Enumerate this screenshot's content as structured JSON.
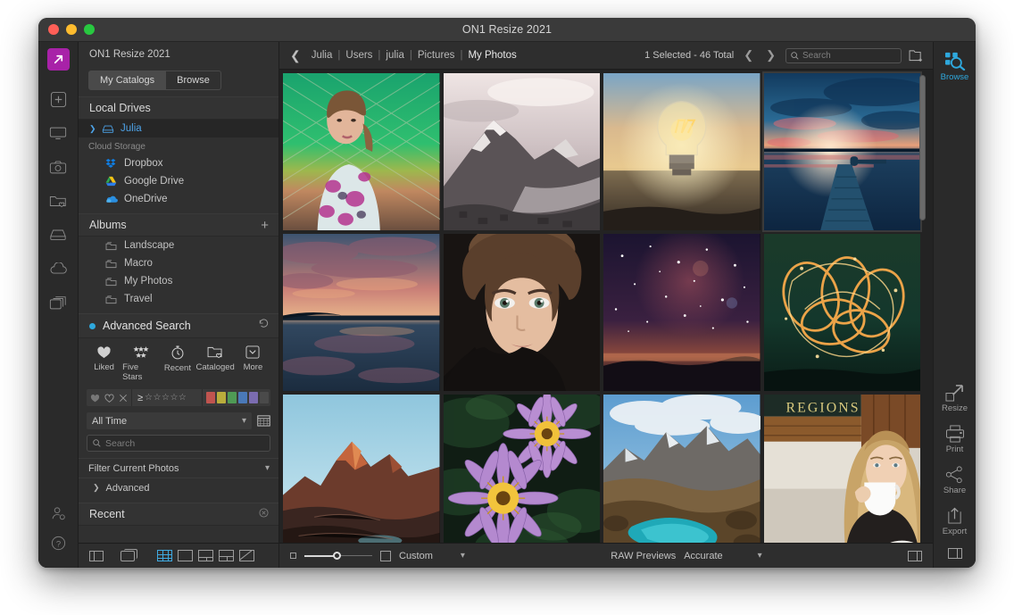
{
  "window": {
    "title": "ON1 Resize 2021",
    "traffic_lights": [
      "close",
      "minimize",
      "zoom"
    ]
  },
  "left_rail": {
    "logo": "on1-logo",
    "icons": [
      "plus-icon",
      "monitor-icon",
      "camera-icon",
      "folder-heart-icon",
      "drive-icon",
      "cloud-icon",
      "copies-icon"
    ],
    "bottom_icons": [
      "user-settings-icon",
      "help-icon"
    ]
  },
  "left_panel": {
    "app_name": "ON1 Resize 2021",
    "tabs": [
      {
        "label": "My Catalogs",
        "active": true
      },
      {
        "label": "Browse",
        "active": false
      }
    ],
    "local_drives": {
      "header": "Local Drives",
      "items": [
        {
          "label": "Julia",
          "selected": true,
          "icon": "drive-icon"
        }
      ]
    },
    "cloud_storage": {
      "header": "Cloud Storage",
      "items": [
        {
          "label": "Dropbox",
          "icon": "dropbox-icon",
          "color": "#0f7ee3"
        },
        {
          "label": "Google Drive",
          "icon": "google-drive-icon",
          "color": "#34a853"
        },
        {
          "label": "OneDrive",
          "icon": "onedrive-icon",
          "color": "#2a8fe0"
        }
      ]
    },
    "albums": {
      "header": "Albums",
      "add_label": "+",
      "items": [
        {
          "label": "Landscape",
          "icon": "album-icon"
        },
        {
          "label": "Macro",
          "icon": "album-icon"
        },
        {
          "label": "My Photos",
          "icon": "album-icon"
        },
        {
          "label": "Travel",
          "icon": "album-icon"
        }
      ]
    },
    "advanced_search": {
      "header": "Advanced Search",
      "bullet_color": "#2ea8dd",
      "reset_icon": "reset-icon",
      "criteria": [
        {
          "label": "Liked",
          "icon": "heart-filled-icon"
        },
        {
          "label": "Five Stars",
          "icon": "five-stars-icon"
        },
        {
          "label": "Recent",
          "icon": "stopwatch-icon"
        },
        {
          "label": "Cataloged",
          "icon": "folder-heart-icon"
        },
        {
          "label": "More",
          "icon": "chevron-down-box-icon"
        }
      ],
      "like_filters": [
        "heart-filled-icon",
        "heart-outline-icon",
        "reject-x-icon"
      ],
      "rating": {
        "operator": "≥",
        "stars": 5,
        "filled": 0
      },
      "color_labels": [
        "#c0544f",
        "#b9ad3c",
        "#4f9a55",
        "#4a79b8",
        "#7b6cb0",
        "#4a4a4a"
      ],
      "time_filter": {
        "value": "All Time",
        "calendar_icon": "calendar-icon"
      },
      "search": {
        "placeholder": "Search",
        "value": "",
        "icon": "search-icon"
      },
      "filter_current": {
        "label": "Filter Current Photos",
        "chevron": "chevron-down-icon"
      },
      "advanced_toggle": {
        "label": "Advanced",
        "chevron": "chevron-right-icon"
      }
    },
    "recent": {
      "header": "Recent",
      "clear_icon": "clear-icon"
    }
  },
  "topbar": {
    "back_icon": "chevron-left-icon",
    "breadcrumb": [
      "Julia",
      "Users",
      "julia",
      "Pictures",
      "My Photos"
    ],
    "status": "1 Selected - 46 Total",
    "prev_icon": "chevron-left-icon",
    "next_icon": "chevron-right-icon",
    "search": {
      "placeholder": "Search",
      "value": "",
      "icon": "search-icon"
    },
    "new_folder_icon": "new-folder-icon"
  },
  "grid": {
    "selected_index": 3,
    "photos": [
      {
        "name": "woman-at-fence",
        "alt": "Woman standing in front of green chain-link fence"
      },
      {
        "name": "snowy-mountain-bay",
        "alt": "Black and white snowy mountain over coastal town"
      },
      {
        "name": "light-bulb-sunset",
        "alt": "Light bulb glowing against sunset sky"
      },
      {
        "name": "sunset-pier",
        "alt": "Wooden pier at blue and pink sunset",
        "selected": true
      },
      {
        "name": "cloud-reflection-lake",
        "alt": "Pink clouds reflected over a calm lake"
      },
      {
        "name": "portrait-woman-closeup",
        "alt": "Close-up portrait of woman with dark background"
      },
      {
        "name": "starry-night-sky",
        "alt": "Night sky with stars and red nebula glow"
      },
      {
        "name": "light-painting-sparks",
        "alt": "Orange sparkler light painting on dark background"
      },
      {
        "name": "red-rock-mountain",
        "alt": "Red rock mountain peak under blue sky"
      },
      {
        "name": "purple-water-lilies",
        "alt": "Two purple water lilies with yellow centers"
      },
      {
        "name": "turquoise-mountain-lake",
        "alt": "Turquoise lake between autumn mountains"
      },
      {
        "name": "woman-drinking-coffee",
        "alt": "Blonde woman drinking from a white mug in a cafe"
      }
    ]
  },
  "bottombar": {
    "thumb_small_icon": "small-square-icon",
    "thumb_large_icon": "large-square-icon",
    "zoom_value": 45,
    "view_mode": {
      "label": "Custom",
      "chevron": "chevron-down-icon"
    },
    "raw_previews_label": "RAW Previews",
    "raw_previews_value": {
      "label": "Accurate",
      "chevron": "chevron-down-icon"
    },
    "right_panel_toggle_icon": "panel-toggle-icon"
  },
  "viewbar": {
    "icons": [
      "left-panel-toggle-icon",
      "filmstrip-icon",
      "grid-view-icon",
      "detail-view-icon",
      "compare-view-icon",
      "map-view-icon",
      "focus-view-icon"
    ],
    "active": "grid-view-icon"
  },
  "right_rail": {
    "modules": [
      {
        "label": "Browse",
        "icon": "browse-icon",
        "active": true
      },
      {
        "label": "Resize",
        "icon": "resize-icon",
        "active": false
      },
      {
        "label": "Print",
        "icon": "print-icon",
        "active": false
      },
      {
        "label": "Share",
        "icon": "share-icon",
        "active": false
      },
      {
        "label": "Export",
        "icon": "export-icon",
        "active": false
      }
    ],
    "bottom_icon": "panel-toggle-icon"
  },
  "colors": {
    "accent": "#2ea8dd",
    "link": "#4da3e8",
    "brand": "#a822a8",
    "window_bg": "#2b2b2b",
    "panel_bg": "#303030",
    "grid_bg": "#232323"
  }
}
